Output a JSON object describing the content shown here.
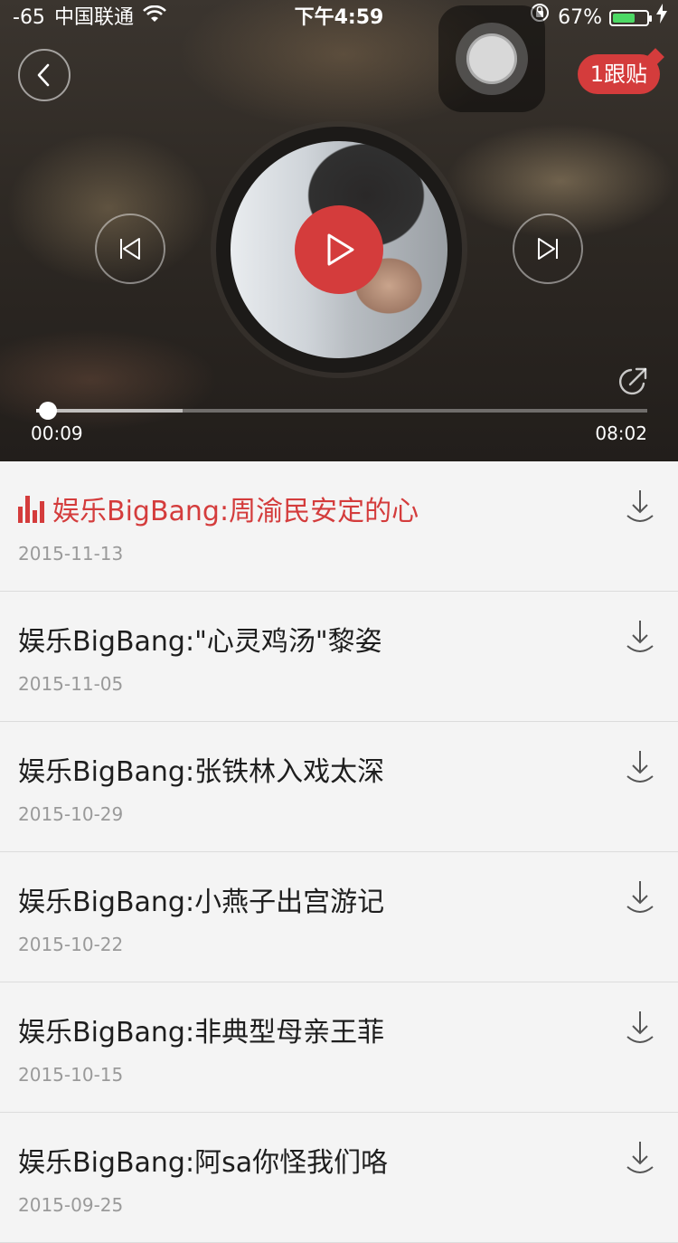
{
  "status_bar": {
    "signal": "-65",
    "carrier": "中国联通",
    "time": "下午4:59",
    "battery_text": "67%",
    "battery_level": 0.67
  },
  "header": {
    "comment_badge": "1跟贴"
  },
  "player": {
    "current_time": "00:09",
    "total_time": "08:02",
    "progress": 0.019,
    "buffered": 0.24,
    "accent_color": "#d43c3c"
  },
  "episodes": [
    {
      "title": "娱乐BigBang:周渝民安定的心",
      "date": "2015-11-13",
      "playing": true
    },
    {
      "title": "娱乐BigBang:\"心灵鸡汤\"黎姿",
      "date": "2015-11-05"
    },
    {
      "title": "娱乐BigBang:张铁林入戏太深",
      "date": "2015-10-29"
    },
    {
      "title": "娱乐BigBang:小燕子出宫游记",
      "date": "2015-10-22"
    },
    {
      "title": "娱乐BigBang:非典型母亲王菲",
      "date": "2015-10-15"
    },
    {
      "title": "娱乐BigBang:阿sa你怪我们咯",
      "date": "2015-09-25"
    }
  ]
}
